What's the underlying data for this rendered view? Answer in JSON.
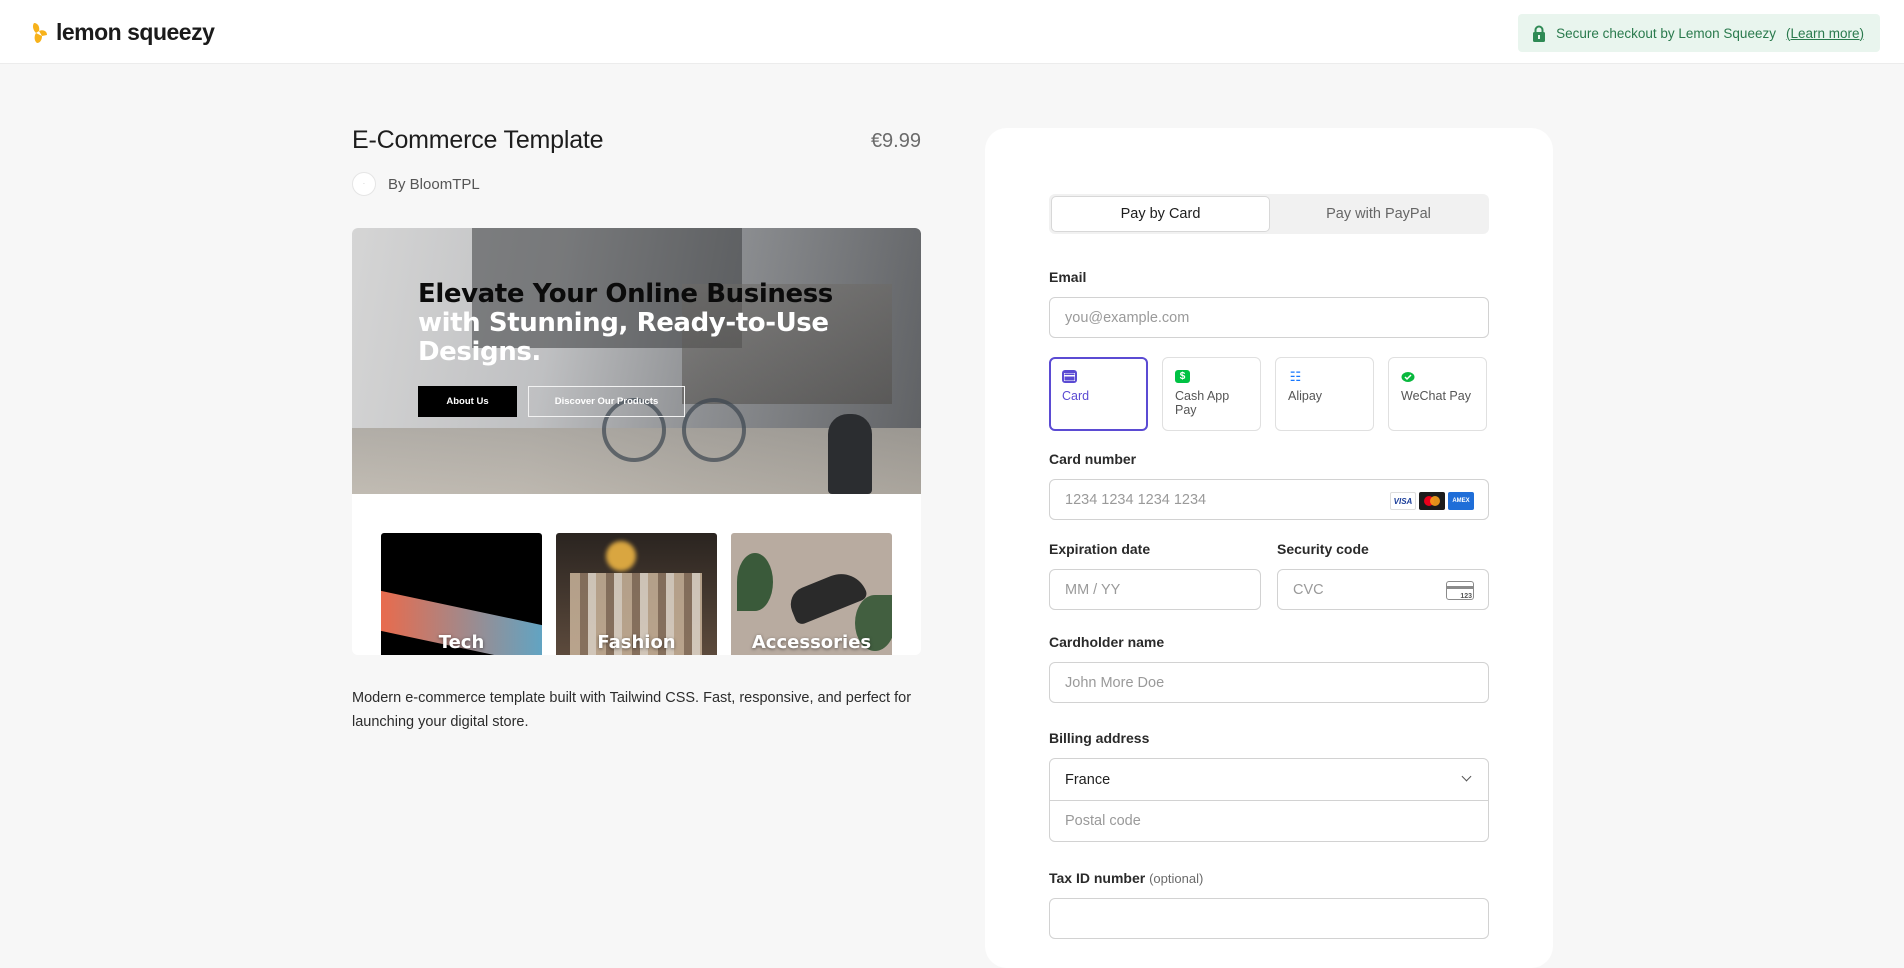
{
  "header": {
    "brand": "lemon squeezy",
    "secure_text": "Secure checkout by Lemon Squeezy",
    "learn_more": "(Learn more)",
    "colors": {
      "brand_yellow": "#f7b21b",
      "secure_bg": "#e9f5ee",
      "secure_text": "#2a7a4d"
    }
  },
  "product": {
    "title": "E-Commerce Template",
    "price": "€9.99",
    "seller": "By BloomTPL",
    "preview": {
      "hero_line1": "Elevate Your Online Business",
      "hero_line2": "with Stunning, Ready-to-Use",
      "hero_line3": "Designs.",
      "button_about": "About Us",
      "button_discover": "Discover Our Products",
      "categories": [
        "Tech",
        "Fashion",
        "Accessories"
      ]
    },
    "description": "Modern e-commerce template built with Tailwind CSS. Fast, responsive, and perfect for launching your digital store."
  },
  "checkout": {
    "tabs": [
      "Pay by Card",
      "Pay with PayPal"
    ],
    "active_tab": "Pay by Card",
    "email_label": "Email",
    "email_placeholder": "you@example.com",
    "methods": [
      {
        "label": "Card",
        "icon": "card-icon",
        "color": "#5b4bd3"
      },
      {
        "label": "Cash App Pay",
        "icon": "cash-app-icon",
        "color": "#00c244"
      },
      {
        "label": "Alipay",
        "icon": "alipay-icon",
        "color": "#1677ff"
      },
      {
        "label": "WeChat Pay",
        "icon": "wechat-icon",
        "color": "#09b83e"
      }
    ],
    "active_method": "Card",
    "card_number_label": "Card number",
    "card_number_placeholder": "1234 1234 1234 1234",
    "card_brands": [
      "VISA",
      "Mastercard",
      "AMEX"
    ],
    "expiration_label": "Expiration date",
    "expiration_placeholder": "MM / YY",
    "security_label": "Security code",
    "security_placeholder": "CVC",
    "cvc_icon_text": "123",
    "cardholder_label": "Cardholder name",
    "cardholder_placeholder": "John More Doe",
    "billing_label": "Billing address",
    "country_value": "France",
    "postal_placeholder": "Postal code",
    "tax_label": "Tax ID number",
    "tax_optional": "(optional)",
    "accent_color": "#5b4bd3"
  }
}
